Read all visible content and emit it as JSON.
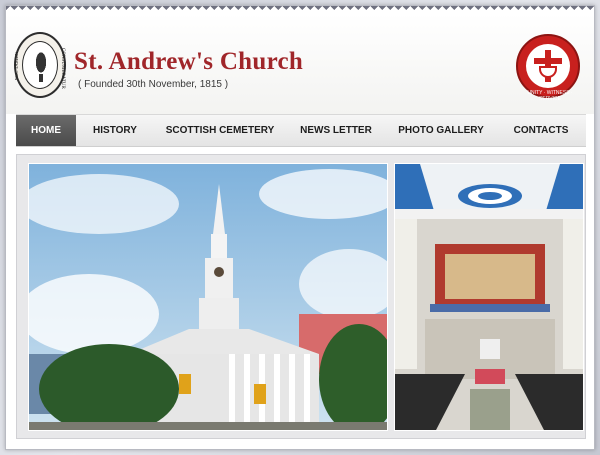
{
  "header": {
    "title": "St. Andrew's Church",
    "subtitle": "( Founded 30th November, 1815 )",
    "left_seal": {
      "icon": "church-seal-icon",
      "text_left": "NEC TAMEN",
      "text_right": "CONSUMEBATUR"
    },
    "right_seal": {
      "icon": "church-of-north-india-logo-icon",
      "text": "UNITY · WITNESS · SERVICE",
      "color": "#c8201e"
    }
  },
  "nav": {
    "items": [
      {
        "label": "HOME",
        "active": true
      },
      {
        "label": "HISTORY",
        "active": false
      },
      {
        "label": "SCOTTISH CEMETERY",
        "active": false
      },
      {
        "label": "NEWS LETTER",
        "active": false
      },
      {
        "label": "PHOTO GALLERY",
        "active": false
      },
      {
        "label": "CONTACTS",
        "active": false
      }
    ],
    "active_color": "#555555"
  },
  "photos": [
    {
      "name": "church-exterior-photo"
    },
    {
      "name": "church-interior-photo"
    }
  ],
  "colors": {
    "title": "#a0262a",
    "nav_text": "#1d1d1d"
  }
}
